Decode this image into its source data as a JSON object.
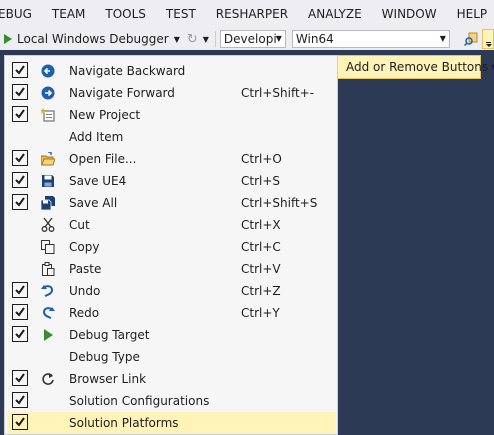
{
  "menubar": {
    "items": [
      "EBUG",
      "TEAM",
      "TOOLS",
      "TEST",
      "RESHARPER",
      "ANALYZE",
      "WINDOW",
      "HELP"
    ]
  },
  "toolbar": {
    "debugger_label": "Local Windows Debugger",
    "configuration_value": "Developi",
    "platform_value": "Win64"
  },
  "add_remove_label": "Add or Remove Buttons",
  "menu": {
    "items": [
      {
        "label": "Navigate Backward",
        "shortcut": "",
        "checked": true,
        "icon": "navigate-backward-icon"
      },
      {
        "label": "Navigate Forward",
        "shortcut": "Ctrl+Shift+-",
        "checked": true,
        "icon": "navigate-forward-icon"
      },
      {
        "label": "New Project",
        "shortcut": "",
        "checked": true,
        "icon": "new-project-icon"
      },
      {
        "label": "Add Item",
        "shortcut": "",
        "checked": false,
        "icon": ""
      },
      {
        "label": "Open File...",
        "shortcut": "Ctrl+O",
        "checked": true,
        "icon": "open-file-icon"
      },
      {
        "label": "Save UE4",
        "shortcut": "Ctrl+S",
        "checked": true,
        "icon": "save-icon"
      },
      {
        "label": "Save All",
        "shortcut": "Ctrl+Shift+S",
        "checked": true,
        "icon": "save-all-icon"
      },
      {
        "label": "Cut",
        "shortcut": "Ctrl+X",
        "checked": false,
        "icon": "cut-icon"
      },
      {
        "label": "Copy",
        "shortcut": "Ctrl+C",
        "checked": false,
        "icon": "copy-icon"
      },
      {
        "label": "Paste",
        "shortcut": "Ctrl+V",
        "checked": false,
        "icon": "paste-icon"
      },
      {
        "label": "Undo",
        "shortcut": "Ctrl+Z",
        "checked": true,
        "icon": "undo-icon"
      },
      {
        "label": "Redo",
        "shortcut": "Ctrl+Y",
        "checked": true,
        "icon": "redo-icon"
      },
      {
        "label": "Debug Target",
        "shortcut": "",
        "checked": true,
        "icon": "play-icon"
      },
      {
        "label": "Debug Type",
        "shortcut": "",
        "checked": false,
        "icon": ""
      },
      {
        "label": "Browser Link",
        "shortcut": "",
        "checked": true,
        "icon": "refresh-icon"
      },
      {
        "label": "Solution Configurations",
        "shortcut": "",
        "checked": true,
        "icon": ""
      },
      {
        "label": "Solution Platforms",
        "shortcut": "",
        "checked": true,
        "icon": ""
      }
    ]
  },
  "colors": {
    "background": "#2d3a56",
    "chrome": "#eeeef2",
    "menu_bg": "#f6f6f6",
    "highlight": "#fff3b8",
    "accent_blue": "#1e5fb0",
    "play_green": "#388a34"
  }
}
